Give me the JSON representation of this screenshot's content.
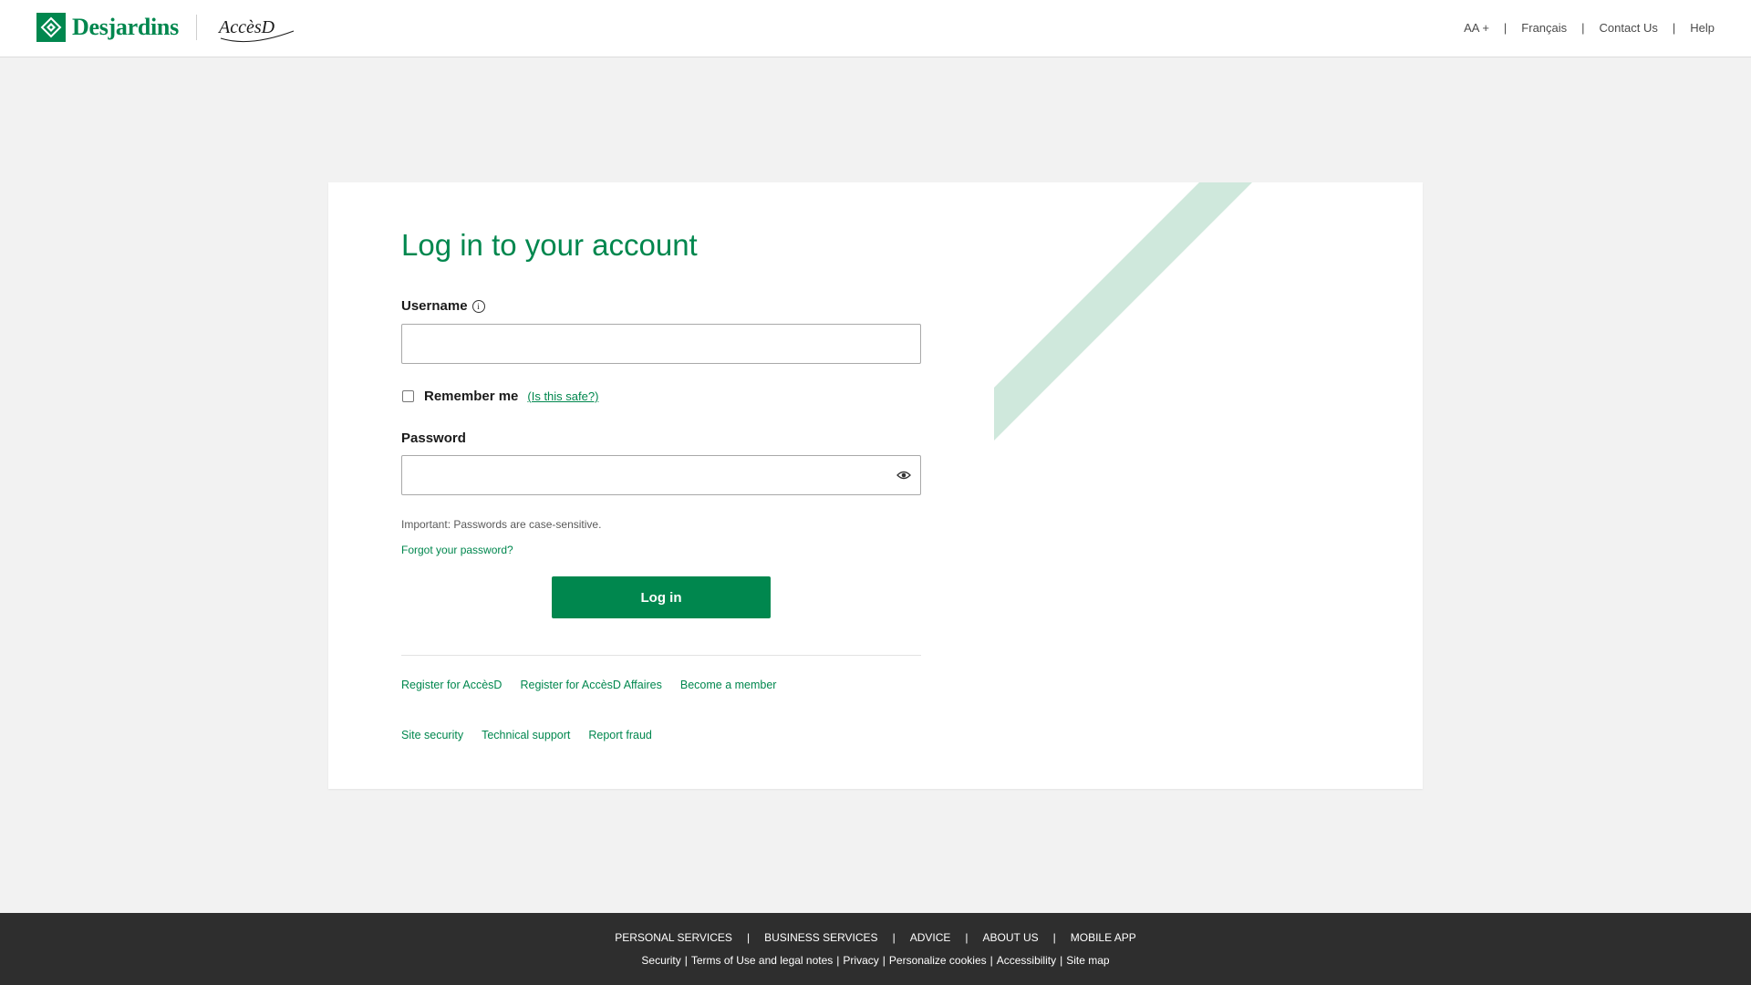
{
  "header": {
    "brand": "Desjardins",
    "product": "AccèsD",
    "nav": [
      "AA +",
      "Français",
      "Contact Us",
      "Help"
    ],
    "separator": "|"
  },
  "login": {
    "title": "Log in to your account",
    "username_label": "Username",
    "username_value": "",
    "remember_label": "Remember me",
    "remember_checked": false,
    "is_safe_link": "(Is this safe?)",
    "password_label": "Password",
    "password_value": "",
    "note": "Important: Passwords are case-sensitive.",
    "forgot": "Forgot your password?",
    "login_button": "Log in",
    "links_row1": [
      "Register for AccèsD",
      "Register for AccèsD Affaires",
      "Become a member"
    ],
    "links_row2": [
      "Site security",
      "Technical support",
      "Report fraud"
    ]
  },
  "footer": {
    "nav": [
      "PERSONAL SERVICES",
      "BUSINESS SERVICES",
      "ADVICE",
      "ABOUT US",
      "MOBILE APP"
    ],
    "nav_sep": "|",
    "links": [
      "Security",
      "Terms of Use and legal notes",
      "Privacy",
      "Personalize cookies",
      "Accessibility",
      "Site map"
    ],
    "links_sep": "|"
  },
  "colors": {
    "brand_green": "#00874e",
    "deco_stripe": "#cfe8dc",
    "footer_bg": "#2e2e2e",
    "page_bg": "#f2f2f2"
  }
}
